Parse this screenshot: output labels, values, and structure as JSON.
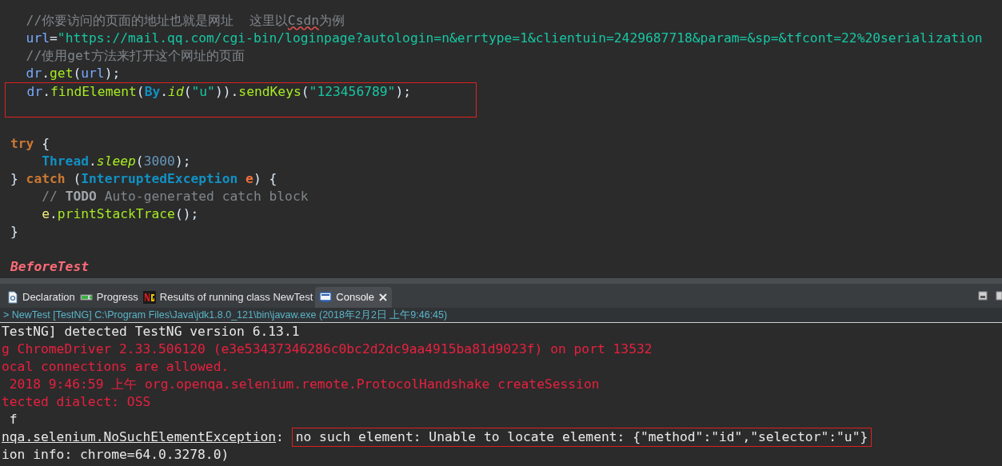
{
  "editor": {
    "lines": [
      {
        "highlighted": false,
        "tokens": [
          {
            "kind": "comment",
            "text": "  //你要访问的页面的地址也就是网址  这里以"
          },
          {
            "kind": "misspelled",
            "text": "Csdn"
          },
          {
            "kind": "comment",
            "text": "为例"
          }
        ]
      },
      {
        "highlighted": false,
        "tokens": [
          {
            "kind": "variable",
            "text": "  url"
          },
          {
            "kind": "plain",
            "text": "="
          },
          {
            "kind": "string",
            "text": "\"https://mail.qq.com/cgi-bin/loginpage?autologin=n&errtype=1&clientuin=2429687718&param=&sp=&tfcont=22%20serialization"
          }
        ]
      },
      {
        "highlighted": false,
        "tokens": [
          {
            "kind": "comment",
            "text": "  //使用get方法来打开这个网址的页面"
          }
        ]
      },
      {
        "highlighted": false,
        "tokens": [
          {
            "kind": "variable",
            "text": "  dr"
          },
          {
            "kind": "plain",
            "text": "."
          },
          {
            "kind": "method",
            "text": "get"
          },
          {
            "kind": "plain",
            "text": "("
          },
          {
            "kind": "variable",
            "text": "url"
          },
          {
            "kind": "plain",
            "text": ");"
          }
        ]
      },
      {
        "highlighted": true,
        "tokens": [
          {
            "kind": "variable",
            "text": "  dr"
          },
          {
            "kind": "plain",
            "text": "."
          },
          {
            "kind": "method",
            "text": "findElement"
          },
          {
            "kind": "plain",
            "text": "("
          },
          {
            "kind": "type",
            "text": "By"
          },
          {
            "kind": "plain",
            "text": "."
          },
          {
            "kind": "static",
            "text": "id"
          },
          {
            "kind": "plain",
            "text": "("
          },
          {
            "kind": "string",
            "text": "\"u\""
          },
          {
            "kind": "plain",
            "text": "))."
          },
          {
            "kind": "method",
            "text": "sendKeys"
          },
          {
            "kind": "plain",
            "text": "("
          },
          {
            "kind": "string",
            "text": "\"123456789\""
          },
          {
            "kind": "plain",
            "text": ");"
          }
        ]
      },
      {
        "highlighted": false
      },
      {
        "highlighted": false,
        "tokens": [
          {
            "kind": "keyword",
            "text": "try"
          },
          {
            "kind": "plain",
            "text": " {"
          }
        ]
      },
      {
        "highlighted": false,
        "tokens": [
          {
            "kind": "type",
            "text": "    Thread"
          },
          {
            "kind": "plain",
            "text": "."
          },
          {
            "kind": "static",
            "text": "sleep"
          },
          {
            "kind": "plain",
            "text": "("
          },
          {
            "kind": "number",
            "text": "3000"
          },
          {
            "kind": "plain",
            "text": ");"
          }
        ]
      },
      {
        "highlighted": false,
        "tokens": [
          {
            "kind": "plain",
            "text": "} "
          },
          {
            "kind": "keyword",
            "text": "catch"
          },
          {
            "kind": "plain",
            "text": " ("
          },
          {
            "kind": "type",
            "text": "InterruptedException"
          },
          {
            "kind": "param",
            "text": " e"
          },
          {
            "kind": "plain",
            "text": ") {"
          }
        ]
      },
      {
        "highlighted": false,
        "tokens": [
          {
            "kind": "comment",
            "text": "    // "
          },
          {
            "kind": "todo",
            "text": "TODO"
          },
          {
            "kind": "comment",
            "text": " Auto-generated catch block"
          }
        ]
      },
      {
        "highlighted": false,
        "tokens": [
          {
            "kind": "local",
            "text": "    e"
          },
          {
            "kind": "plain",
            "text": "."
          },
          {
            "kind": "method",
            "text": "printStackTrace"
          },
          {
            "kind": "plain",
            "text": "();"
          }
        ]
      },
      {
        "highlighted": false,
        "tokens": [
          {
            "kind": "plain",
            "text": "}"
          }
        ]
      },
      {
        "highlighted": false
      },
      {
        "highlighted": false,
        "tokens": [
          {
            "kind": "annotation",
            "text": "BeforeTest"
          }
        ]
      }
    ]
  },
  "tabs": [
    {
      "kind": "declaration",
      "label": "Declaration",
      "selected": false
    },
    {
      "kind": "progress",
      "label": "Progress",
      "selected": false
    },
    {
      "kind": "testng",
      "label": "Results of running class NewTest",
      "selected": false
    },
    {
      "kind": "console",
      "label": "Console",
      "selected": true
    }
  ],
  "console": {
    "launch": "> NewTest [TestNG] C:\\Program Files\\Java\\jdk1.8.0_121\\bin\\javaw.exe (2018年2月2日 上午9:46:45)",
    "lines": [
      [
        {
          "kind": "out",
          "text": "TestNG] detected TestNG version 6.13.1"
        }
      ],
      [
        {
          "kind": "err",
          "text": "g ChromeDriver 2.33.506120 (e3e53437346286c0bc2d2dc9aa4915ba81d9023f) on port 13532"
        }
      ],
      [
        {
          "kind": "err",
          "text": "ocal connections are allowed."
        }
      ],
      [
        {
          "kind": "err",
          "text": " 2018 9:46:59 上午 org.openqa.selenium.remote.ProtocolHandshake createSession"
        }
      ],
      [
        {
          "kind": "err",
          "text": "tected dialect: OSS"
        }
      ],
      [
        {
          "kind": "out",
          "text": " f"
        }
      ],
      [
        {
          "kind": "link",
          "text": "nqa.selenium.NoSuchElementException"
        },
        {
          "kind": "out",
          "text": ": "
        },
        {
          "kind": "highlight",
          "text": "no such element: Unable to locate element: {\"method\":\"id\",\"selector\":\"u\"}"
        }
      ],
      [
        {
          "kind": "out",
          "text": "ion info: chrome=64.0.3278.0)"
        }
      ]
    ]
  }
}
